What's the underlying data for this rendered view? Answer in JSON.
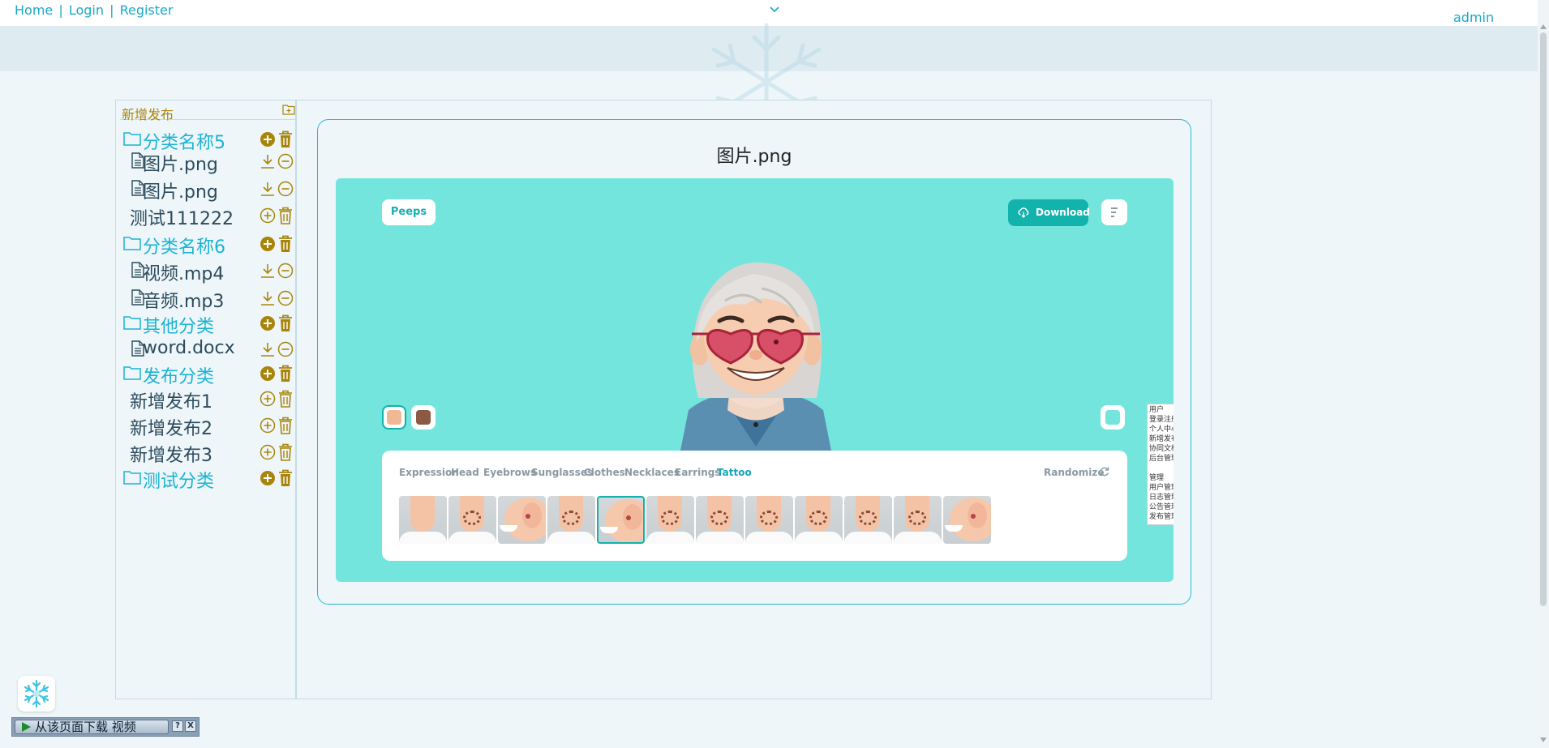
{
  "topbar": {
    "links": [
      "Home",
      "Login",
      "Register"
    ],
    "separator": "|",
    "user": "admin"
  },
  "sidebar": {
    "header": "新增发布",
    "items": [
      {
        "type": "folder",
        "label": "分类名称5"
      },
      {
        "type": "file",
        "label": "图片.png"
      },
      {
        "type": "file",
        "label": "图片.png"
      },
      {
        "type": "plain",
        "label": "测试111222"
      },
      {
        "type": "folder",
        "label": "分类名称6"
      },
      {
        "type": "file",
        "label": "视频.mp4"
      },
      {
        "type": "file",
        "label": "音频.mp3"
      },
      {
        "type": "folder",
        "label": "其他分类"
      },
      {
        "type": "file",
        "label": "word.docx"
      },
      {
        "type": "folder",
        "label": "发布分类"
      },
      {
        "type": "plain",
        "label": "新增发布1"
      },
      {
        "type": "plain",
        "label": "新增发布2"
      },
      {
        "type": "plain",
        "label": "新增发布3"
      },
      {
        "type": "folder",
        "label": "测试分类"
      }
    ]
  },
  "preview": {
    "title": "图片.png",
    "app": {
      "brand": "Peeps",
      "download_label": "Download",
      "skin_colors": [
        "#f0b894",
        "#8a5a44"
      ],
      "background_color": "#74e5dd",
      "tabs": [
        "Expression",
        "Head",
        "Eyebrows",
        "Sunglasses",
        "Clothes",
        "Necklaces",
        "Earrings",
        "Tattoo"
      ],
      "active_tab": "Tattoo",
      "randomize_label": "Randomize",
      "popup_lines": [
        "用户",
        "登录注册",
        "个人中心",
        "新增发布",
        "协同文档",
        "后台管理",
        "",
        "管理",
        "用户管理",
        "日志管理",
        "公告管理",
        "发布管理"
      ],
      "thumbnails": [
        {
          "kind": "neck",
          "tattoo": false,
          "selected": false
        },
        {
          "kind": "neck",
          "tattoo": true,
          "selected": false
        },
        {
          "kind": "face",
          "tattoo": false,
          "selected": false
        },
        {
          "kind": "neck",
          "tattoo": true,
          "selected": false
        },
        {
          "kind": "face",
          "tattoo": false,
          "selected": true
        },
        {
          "kind": "neck",
          "tattoo": true,
          "selected": false
        },
        {
          "kind": "neck",
          "tattoo": true,
          "selected": false
        },
        {
          "kind": "neck",
          "tattoo": true,
          "selected": false
        },
        {
          "kind": "neck",
          "tattoo": true,
          "selected": false
        },
        {
          "kind": "neck",
          "tattoo": true,
          "selected": false
        },
        {
          "kind": "neck",
          "tattoo": true,
          "selected": false
        },
        {
          "kind": "face",
          "tattoo": false,
          "selected": false
        }
      ]
    }
  },
  "download_bar": {
    "label": "从该页面下载 视频",
    "help": "?",
    "close": "X"
  }
}
